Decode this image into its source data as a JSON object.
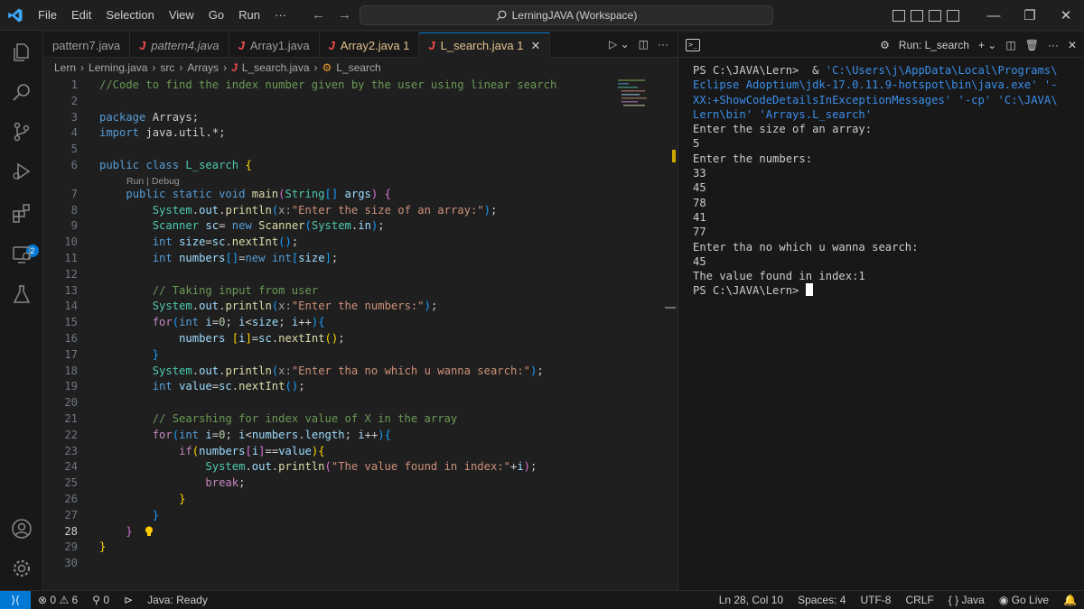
{
  "menu": [
    "File",
    "Edit",
    "Selection",
    "View",
    "Go",
    "Run",
    "···"
  ],
  "search": {
    "text": "LerningJAVA (Workspace)"
  },
  "tabs": [
    {
      "label": "pattern7.java",
      "active": false
    },
    {
      "label": "pattern4.java",
      "active": false
    },
    {
      "label": "Array1.java",
      "active": false
    },
    {
      "label": "Array2.java",
      "badge": "1",
      "active": false
    },
    {
      "label": "L_search.java",
      "badge": "1",
      "active": true
    }
  ],
  "breadcrumb": [
    "Lern",
    "Lerning.java",
    "src",
    "Arrays",
    "L_search.java",
    "L_search"
  ],
  "codelens": "Run | Debug",
  "code": [
    {
      "n": "1",
      "segs": [
        [
          "cm",
          "//Code to find the index number given by the user using linear search"
        ]
      ]
    },
    {
      "n": "2",
      "segs": []
    },
    {
      "n": "3",
      "segs": [
        [
          "kw",
          "package "
        ],
        [
          "pl",
          "Arrays;"
        ]
      ]
    },
    {
      "n": "4",
      "segs": [
        [
          "kw",
          "import "
        ],
        [
          "pl",
          "java.util.*;"
        ]
      ]
    },
    {
      "n": "5",
      "segs": []
    },
    {
      "n": "6",
      "segs": [
        [
          "kw",
          "public class "
        ],
        [
          "ty",
          "L_search "
        ],
        [
          "br1",
          "{"
        ]
      ]
    },
    {
      "n": "7",
      "segs": [
        [
          "pl",
          "    "
        ],
        [
          "kw",
          "public static void "
        ],
        [
          "fn",
          "main"
        ],
        [
          "br2",
          "("
        ],
        [
          "ty",
          "String"
        ],
        [
          "br3",
          "[]"
        ],
        [
          "var",
          " args"
        ],
        [
          "br2",
          ")"
        ],
        [
          "pl",
          " "
        ],
        [
          "br2",
          "{"
        ]
      ]
    },
    {
      "n": "8",
      "segs": [
        [
          "pl",
          "        "
        ],
        [
          "ty",
          "System"
        ],
        [
          "pl",
          "."
        ],
        [
          "var",
          "out"
        ],
        [
          "pl",
          "."
        ],
        [
          "fn",
          "println"
        ],
        [
          "br3",
          "("
        ],
        [
          "hint",
          "x:"
        ],
        [
          "str",
          "\"Enter the size of an array:\""
        ],
        [
          "br3",
          ")"
        ],
        [
          "pl",
          ";"
        ]
      ]
    },
    {
      "n": "9",
      "segs": [
        [
          "pl",
          "        "
        ],
        [
          "ty",
          "Scanner "
        ],
        [
          "var",
          "sc"
        ],
        [
          "pl",
          "= "
        ],
        [
          "kw",
          "new "
        ],
        [
          "fn",
          "Scanner"
        ],
        [
          "br3",
          "("
        ],
        [
          "ty",
          "System"
        ],
        [
          "pl",
          "."
        ],
        [
          "var",
          "in"
        ],
        [
          "br3",
          ")"
        ],
        [
          "pl",
          ";"
        ]
      ]
    },
    {
      "n": "10",
      "segs": [
        [
          "pl",
          "        "
        ],
        [
          "kw",
          "int "
        ],
        [
          "var",
          "size"
        ],
        [
          "pl",
          "="
        ],
        [
          "var",
          "sc"
        ],
        [
          "pl",
          "."
        ],
        [
          "fn",
          "nextInt"
        ],
        [
          "br3",
          "()"
        ],
        [
          "pl",
          ";"
        ]
      ]
    },
    {
      "n": "11",
      "segs": [
        [
          "pl",
          "        "
        ],
        [
          "kw",
          "int "
        ],
        [
          "var",
          "numbers"
        ],
        [
          "br3",
          "[]"
        ],
        [
          "pl",
          "="
        ],
        [
          "kw",
          "new "
        ],
        [
          "kw",
          "int"
        ],
        [
          "br3",
          "["
        ],
        [
          "var",
          "size"
        ],
        [
          "br3",
          "]"
        ],
        [
          "pl",
          ";"
        ]
      ]
    },
    {
      "n": "12",
      "segs": []
    },
    {
      "n": "13",
      "segs": [
        [
          "pl",
          "        "
        ],
        [
          "cm",
          "// Taking input from user"
        ]
      ]
    },
    {
      "n": "14",
      "segs": [
        [
          "pl",
          "        "
        ],
        [
          "ty",
          "System"
        ],
        [
          "pl",
          "."
        ],
        [
          "var",
          "out"
        ],
        [
          "pl",
          "."
        ],
        [
          "fn",
          "println"
        ],
        [
          "br3",
          "("
        ],
        [
          "hint",
          "x:"
        ],
        [
          "str",
          "\"Enter the numbers:\""
        ],
        [
          "br3",
          ")"
        ],
        [
          "pl",
          ";"
        ]
      ]
    },
    {
      "n": "15",
      "segs": [
        [
          "pl",
          "        "
        ],
        [
          "ctl",
          "for"
        ],
        [
          "br3",
          "("
        ],
        [
          "kw",
          "int "
        ],
        [
          "var",
          "i"
        ],
        [
          "pl",
          "="
        ],
        [
          "num",
          "0"
        ],
        [
          "pl",
          "; "
        ],
        [
          "var",
          "i"
        ],
        [
          "pl",
          "<"
        ],
        [
          "var",
          "size"
        ],
        [
          "pl",
          "; "
        ],
        [
          "var",
          "i"
        ],
        [
          "pl",
          "++"
        ],
        [
          "br3",
          ")"
        ],
        [
          "br3",
          "{"
        ]
      ]
    },
    {
      "n": "16",
      "segs": [
        [
          "pl",
          "            "
        ],
        [
          "var",
          "numbers "
        ],
        [
          "br1",
          "["
        ],
        [
          "var",
          "i"
        ],
        [
          "br1",
          "]"
        ],
        [
          "pl",
          "="
        ],
        [
          "var",
          "sc"
        ],
        [
          "pl",
          "."
        ],
        [
          "fn",
          "nextInt"
        ],
        [
          "br1",
          "()"
        ],
        [
          "pl",
          ";"
        ]
      ]
    },
    {
      "n": "17",
      "segs": [
        [
          "pl",
          "        "
        ],
        [
          "br3",
          "}"
        ]
      ]
    },
    {
      "n": "18",
      "segs": [
        [
          "pl",
          "        "
        ],
        [
          "ty",
          "System"
        ],
        [
          "pl",
          "."
        ],
        [
          "var",
          "out"
        ],
        [
          "pl",
          "."
        ],
        [
          "fn",
          "println"
        ],
        [
          "br3",
          "("
        ],
        [
          "hint",
          "x:"
        ],
        [
          "str",
          "\"Enter tha no which u wanna search:\""
        ],
        [
          "br3",
          ")"
        ],
        [
          "pl",
          ";"
        ]
      ]
    },
    {
      "n": "19",
      "segs": [
        [
          "pl",
          "        "
        ],
        [
          "kw",
          "int "
        ],
        [
          "var",
          "value"
        ],
        [
          "pl",
          "="
        ],
        [
          "var",
          "sc"
        ],
        [
          "pl",
          "."
        ],
        [
          "fn",
          "nextInt"
        ],
        [
          "br3",
          "()"
        ],
        [
          "pl",
          ";"
        ]
      ]
    },
    {
      "n": "20",
      "segs": []
    },
    {
      "n": "21",
      "segs": [
        [
          "pl",
          "        "
        ],
        [
          "cm",
          "// Searshing for index value of X in the array"
        ]
      ]
    },
    {
      "n": "22",
      "segs": [
        [
          "pl",
          "        "
        ],
        [
          "ctl",
          "for"
        ],
        [
          "br3",
          "("
        ],
        [
          "kw",
          "int "
        ],
        [
          "var",
          "i"
        ],
        [
          "pl",
          "="
        ],
        [
          "num",
          "0"
        ],
        [
          "pl",
          "; "
        ],
        [
          "var",
          "i"
        ],
        [
          "pl",
          "<"
        ],
        [
          "var",
          "numbers"
        ],
        [
          "pl",
          "."
        ],
        [
          "var",
          "length"
        ],
        [
          "pl",
          "; "
        ],
        [
          "var",
          "i"
        ],
        [
          "pl",
          "++"
        ],
        [
          "br3",
          ")"
        ],
        [
          "br3",
          "{"
        ]
      ]
    },
    {
      "n": "23",
      "segs": [
        [
          "pl",
          "            "
        ],
        [
          "ctl",
          "if"
        ],
        [
          "br1",
          "("
        ],
        [
          "var",
          "numbers"
        ],
        [
          "br2",
          "["
        ],
        [
          "var",
          "i"
        ],
        [
          "br2",
          "]"
        ],
        [
          "pl",
          "=="
        ],
        [
          "var",
          "value"
        ],
        [
          "br1",
          ")"
        ],
        [
          "br1",
          "{"
        ]
      ]
    },
    {
      "n": "24",
      "segs": [
        [
          "pl",
          "                "
        ],
        [
          "ty",
          "System"
        ],
        [
          "pl",
          "."
        ],
        [
          "var",
          "out"
        ],
        [
          "pl",
          "."
        ],
        [
          "fn",
          "println"
        ],
        [
          "br2",
          "("
        ],
        [
          "str",
          "\"The value found in index:\""
        ],
        [
          "pl",
          "+"
        ],
        [
          "var",
          "i"
        ],
        [
          "br2",
          ")"
        ],
        [
          "pl",
          ";"
        ]
      ]
    },
    {
      "n": "25",
      "segs": [
        [
          "pl",
          "                "
        ],
        [
          "ctl",
          "break"
        ],
        [
          "pl",
          ";"
        ]
      ]
    },
    {
      "n": "26",
      "segs": [
        [
          "pl",
          "            "
        ],
        [
          "br1",
          "}"
        ]
      ]
    },
    {
      "n": "27",
      "segs": [
        [
          "pl",
          "        "
        ],
        [
          "br3",
          "}"
        ]
      ]
    },
    {
      "n": "28",
      "segs": [
        [
          "pl",
          "    "
        ],
        [
          "br2",
          "}"
        ]
      ]
    },
    {
      "n": "29",
      "segs": [
        [
          "br1",
          "}"
        ]
      ]
    },
    {
      "n": "30",
      "segs": []
    }
  ],
  "panel": {
    "title": "Run: L_search"
  },
  "terminal": [
    [
      [
        "pl",
        "PS C:\\JAVA\\Lern>  & "
      ],
      [
        "path",
        "'C:\\Users\\j\\AppData\\Local\\Programs\\"
      ]
    ],
    [
      [
        "path",
        "Eclipse Adoptium\\jdk-17.0.11.9-hotspot\\bin\\java.exe' '-"
      ]
    ],
    [
      [
        "path",
        "XX:+ShowCodeDetailsInExceptionMessages' '-cp' 'C:\\JAVA\\"
      ]
    ],
    [
      [
        "path",
        "Lern\\bin' 'Arrays.L_search'"
      ]
    ],
    [
      [
        "pl",
        "Enter the size of an array:"
      ]
    ],
    [
      [
        "pl",
        "5"
      ]
    ],
    [
      [
        "pl",
        "Enter the numbers:"
      ]
    ],
    [
      [
        "pl",
        "33"
      ]
    ],
    [
      [
        "pl",
        "45"
      ]
    ],
    [
      [
        "pl",
        "78"
      ]
    ],
    [
      [
        "pl",
        "41"
      ]
    ],
    [
      [
        "pl",
        "77"
      ]
    ],
    [
      [
        "pl",
        "Enter tha no which u wanna search:"
      ]
    ],
    [
      [
        "pl",
        "45"
      ]
    ],
    [
      [
        "pl",
        "The value found in index:1"
      ]
    ],
    [
      [
        "pl",
        "PS C:\\JAVA\\Lern> "
      ]
    ]
  ],
  "status": {
    "errors": "0",
    "warnings": "6",
    "ports": "0",
    "java": "Java: Ready",
    "position": "Ln 28, Col 10",
    "spaces": "Spaces: 4",
    "encoding": "UTF-8",
    "eol": "CRLF",
    "language": "Java",
    "golive": "Go Live"
  },
  "activity_badge": "2",
  "colors": {
    "accent": "#0078d4",
    "tab_modified": "#e2c08d",
    "java_icon": "#f14c4c"
  }
}
